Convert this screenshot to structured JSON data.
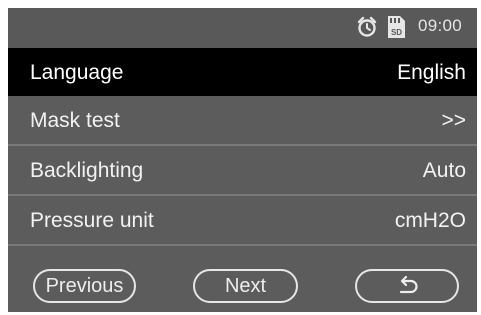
{
  "status_bar": {
    "time": "09:00",
    "icons": [
      "alarm-clock-icon",
      "sd-card-icon"
    ],
    "sd_label": "SD"
  },
  "menu": {
    "items": [
      {
        "label": "Language",
        "value": "English",
        "selected": true
      },
      {
        "label": "Mask test",
        "value": ">>",
        "selected": false
      },
      {
        "label": "Backlighting",
        "value": "Auto",
        "selected": false
      },
      {
        "label": "Pressure unit",
        "value": "cmH2O",
        "selected": false
      }
    ]
  },
  "nav": {
    "previous_label": "Previous",
    "next_label": "Next",
    "back_icon": "return-arrow-icon"
  },
  "colors": {
    "background": "#5c5c5c",
    "selected_row": "#000000",
    "text": "#f2f2f2",
    "divider": "#7a7a7a"
  }
}
